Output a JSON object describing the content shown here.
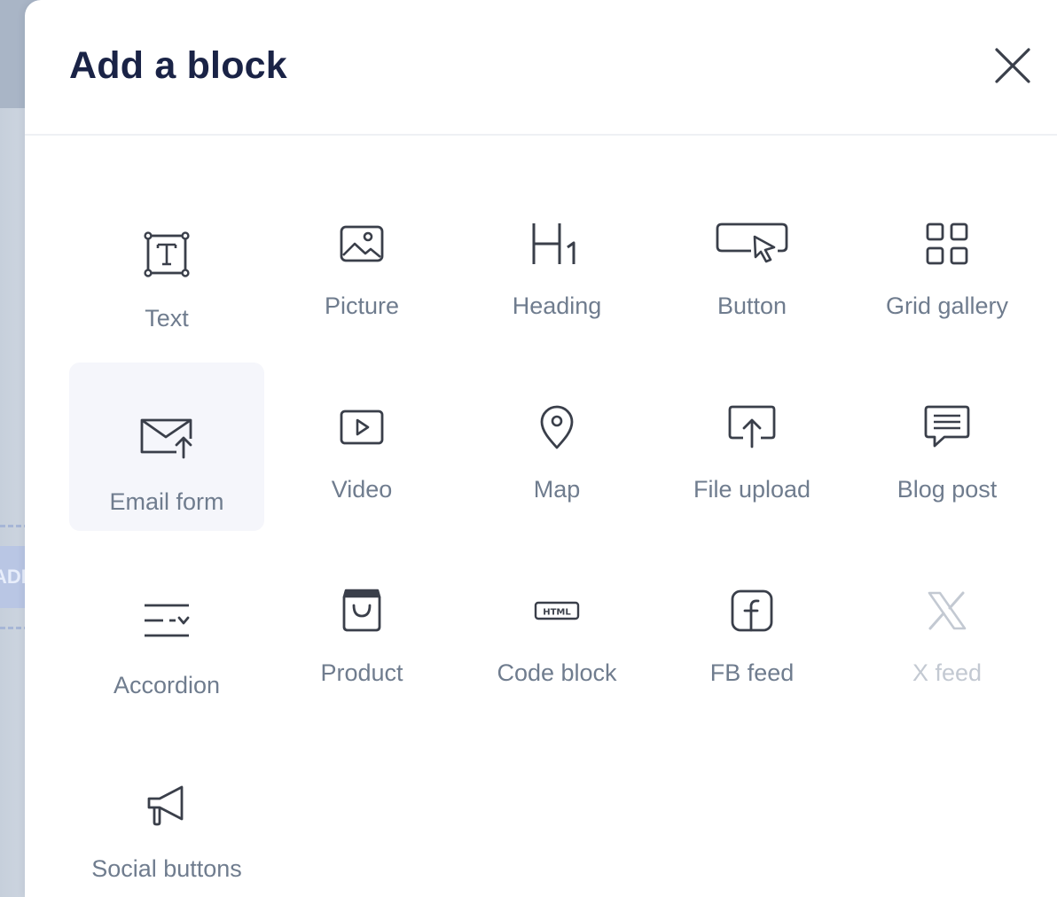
{
  "panel": {
    "title": "Add a block",
    "close_icon": "close-icon"
  },
  "background": {
    "chip_text": "ADD"
  },
  "blocks": [
    {
      "label": "Text",
      "icon": "text-icon",
      "enabled": true
    },
    {
      "label": "Picture",
      "icon": "picture-icon",
      "enabled": true
    },
    {
      "label": "Heading",
      "icon": "heading-icon",
      "enabled": true
    },
    {
      "label": "Button",
      "icon": "button-icon",
      "enabled": true
    },
    {
      "label": "Grid gallery",
      "icon": "grid-gallery-icon",
      "enabled": true
    },
    {
      "label": "Email form",
      "icon": "email-form-icon",
      "enabled": true,
      "selected": true
    },
    {
      "label": "Video",
      "icon": "video-icon",
      "enabled": true
    },
    {
      "label": "Map",
      "icon": "map-pin-icon",
      "enabled": true
    },
    {
      "label": "File upload",
      "icon": "file-upload-icon",
      "enabled": true
    },
    {
      "label": "Blog post",
      "icon": "blog-post-icon",
      "enabled": true
    },
    {
      "label": "Accordion",
      "icon": "accordion-icon",
      "enabled": true
    },
    {
      "label": "Product",
      "icon": "shopping-bag-icon",
      "enabled": true
    },
    {
      "label": "Code block",
      "icon": "html-code-icon",
      "enabled": true
    },
    {
      "label": "FB feed",
      "icon": "facebook-icon",
      "enabled": true
    },
    {
      "label": "X feed",
      "icon": "x-logo-icon",
      "enabled": false
    },
    {
      "label": "Social buttons",
      "icon": "megaphone-icon",
      "enabled": true
    }
  ],
  "colors": {
    "title": "#1a2346",
    "label": "#6f7c8e",
    "label_disabled": "#c3c9d2",
    "icon": "#3a3f4a",
    "selected_bg": "#f5f6fb"
  }
}
